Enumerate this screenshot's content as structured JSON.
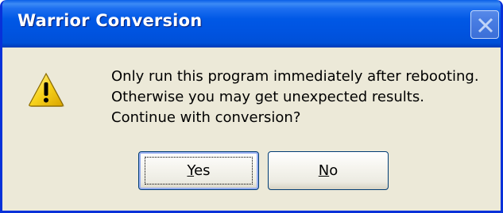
{
  "window": {
    "title": "Warrior Conversion",
    "close_icon": "close-icon"
  },
  "dialog": {
    "icon": "warning-icon",
    "message_lines": [
      "Only run this program immediately after rebooting.",
      "Otherwise you may get unexpected results.",
      "Continue with conversion?"
    ]
  },
  "buttons": {
    "yes": {
      "accel": "Y",
      "rest": "es"
    },
    "no": {
      "accel": "N",
      "rest": "o"
    }
  },
  "colors": {
    "titlebar": "#0058e6",
    "dialog_bg": "#ece9d8",
    "warning_yellow": "#f7d21c"
  }
}
